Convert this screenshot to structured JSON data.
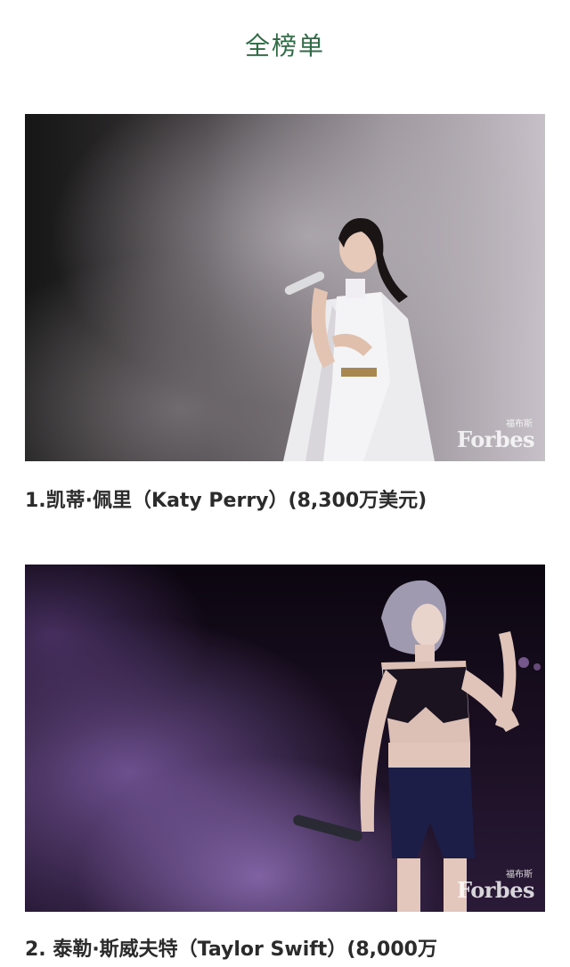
{
  "header": {
    "title": "全榜单"
  },
  "entries": [
    {
      "caption": "1.凯蒂·佩里（Katy Perry）(8,300万美元)",
      "photo_icon": "performer-photo-icon",
      "watermark_cn": "福布斯",
      "watermark_en": "Forbes"
    },
    {
      "caption": "2. 泰勒·斯威夫特（Taylor Swift）(8,000万",
      "photo_icon": "performer-photo-icon",
      "watermark_cn": "福布斯",
      "watermark_en": "Forbes"
    }
  ],
  "colors": {
    "title": "#2f6b44",
    "caption": "#2b2b2b",
    "background": "#ffffff"
  }
}
